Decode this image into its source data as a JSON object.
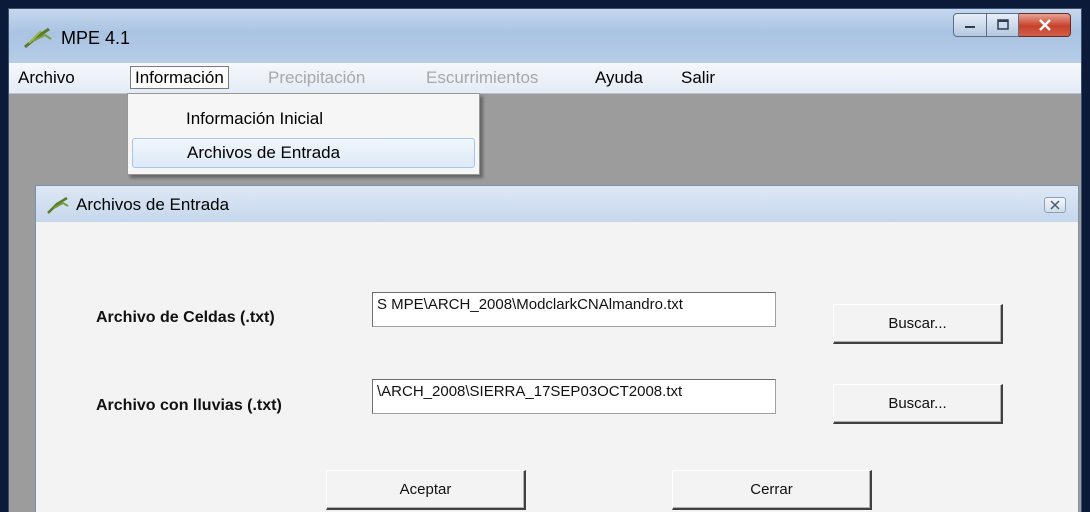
{
  "window": {
    "title": "MPE 4.1",
    "accent_color": "#c7412b"
  },
  "menubar": {
    "items": [
      {
        "label": "Archivo",
        "enabled": true
      },
      {
        "label": "Información",
        "enabled": true,
        "open": true
      },
      {
        "label": "Precipitación",
        "enabled": false
      },
      {
        "label": "Escurrimientos",
        "enabled": false
      },
      {
        "label": "Ayuda",
        "enabled": true
      },
      {
        "label": "Salir",
        "enabled": true
      }
    ]
  },
  "dropdown": {
    "items": [
      {
        "label": "Información Inicial"
      },
      {
        "label": "Archivos de Entrada",
        "highlighted": true
      }
    ]
  },
  "dialog": {
    "title": "Archivos de Entrada",
    "cells_label": "Archivo de Celdas (.txt)",
    "cells_value": "S MPE\\ARCH_2008\\ModclarkCNAlmandro.txt",
    "cells_browse": "Buscar...",
    "rain_label": "Archivo con lluvias (.txt)",
    "rain_value": "\\ARCH_2008\\SIERRA_17SEP03OCT2008.txt",
    "rain_browse": "Buscar...",
    "accept": "Aceptar",
    "close": "Cerrar"
  }
}
